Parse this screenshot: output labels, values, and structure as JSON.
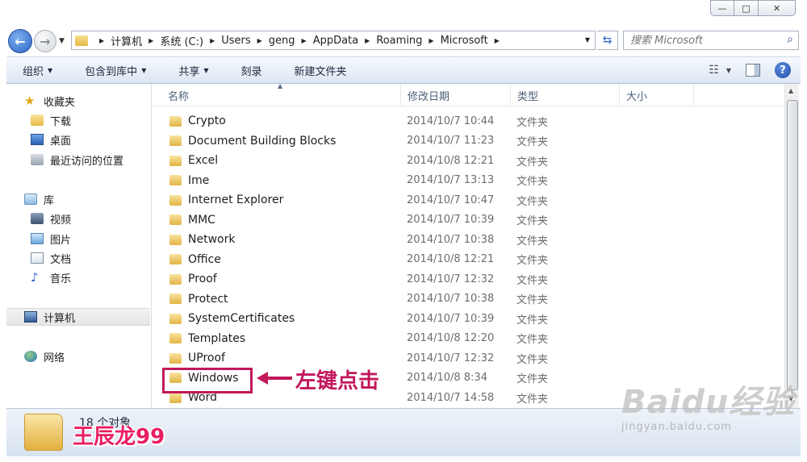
{
  "window": {
    "controls": {
      "minimize": "—",
      "maximize": "□",
      "close": "✕"
    }
  },
  "address": {
    "breadcrumbs": [
      "计算机",
      "系统 (C:)",
      "Users",
      "geng",
      "AppData",
      "Roaming",
      "Microsoft"
    ],
    "search_placeholder": "搜索 Microsoft"
  },
  "toolbar": {
    "organize": "组织",
    "include_in_library": "包含到库中",
    "share": "共享",
    "burn": "刻录",
    "new_folder": "新建文件夹"
  },
  "nav": {
    "favorites": "收藏夹",
    "downloads": "下载",
    "desktop": "桌面",
    "recent": "最近访问的位置",
    "libraries": "库",
    "videos": "视频",
    "pictures": "图片",
    "documents": "文档",
    "music": "音乐",
    "computer": "计算机",
    "network": "网络"
  },
  "columns": {
    "name": "名称",
    "date": "修改日期",
    "type": "类型",
    "size": "大小"
  },
  "files": [
    {
      "name": "Crypto",
      "date": "2014/10/7 10:44",
      "type": "文件夹"
    },
    {
      "name": "Document Building Blocks",
      "date": "2014/10/7 11:23",
      "type": "文件夹"
    },
    {
      "name": "Excel",
      "date": "2014/10/8 12:21",
      "type": "文件夹"
    },
    {
      "name": "Ime",
      "date": "2014/10/7 13:13",
      "type": "文件夹"
    },
    {
      "name": "Internet Explorer",
      "date": "2014/10/7 10:47",
      "type": "文件夹"
    },
    {
      "name": "MMC",
      "date": "2014/10/7 10:39",
      "type": "文件夹"
    },
    {
      "name": "Network",
      "date": "2014/10/7 10:38",
      "type": "文件夹"
    },
    {
      "name": "Office",
      "date": "2014/10/8 12:21",
      "type": "文件夹"
    },
    {
      "name": "Proof",
      "date": "2014/10/7 12:32",
      "type": "文件夹"
    },
    {
      "name": "Protect",
      "date": "2014/10/7 10:38",
      "type": "文件夹"
    },
    {
      "name": "SystemCertificates",
      "date": "2014/10/7 10:39",
      "type": "文件夹"
    },
    {
      "name": "Templates",
      "date": "2014/10/8 12:20",
      "type": "文件夹"
    },
    {
      "name": "UProof",
      "date": "2014/10/7 12:32",
      "type": "文件夹"
    },
    {
      "name": "Windows",
      "date": "2014/10/8 8:34",
      "type": "文件夹"
    },
    {
      "name": "Word",
      "date": "2014/10/7 14:58",
      "type": "文件夹"
    }
  ],
  "status": {
    "count": "18 个对象"
  },
  "annotation": {
    "label": "左键点击",
    "author": "王辰龙99"
  },
  "watermark": {
    "brand": "Baidu经验",
    "url": "jingyan.baidu.com"
  },
  "colors": {
    "annotation": "#c2185b",
    "author": "#e91e63"
  }
}
